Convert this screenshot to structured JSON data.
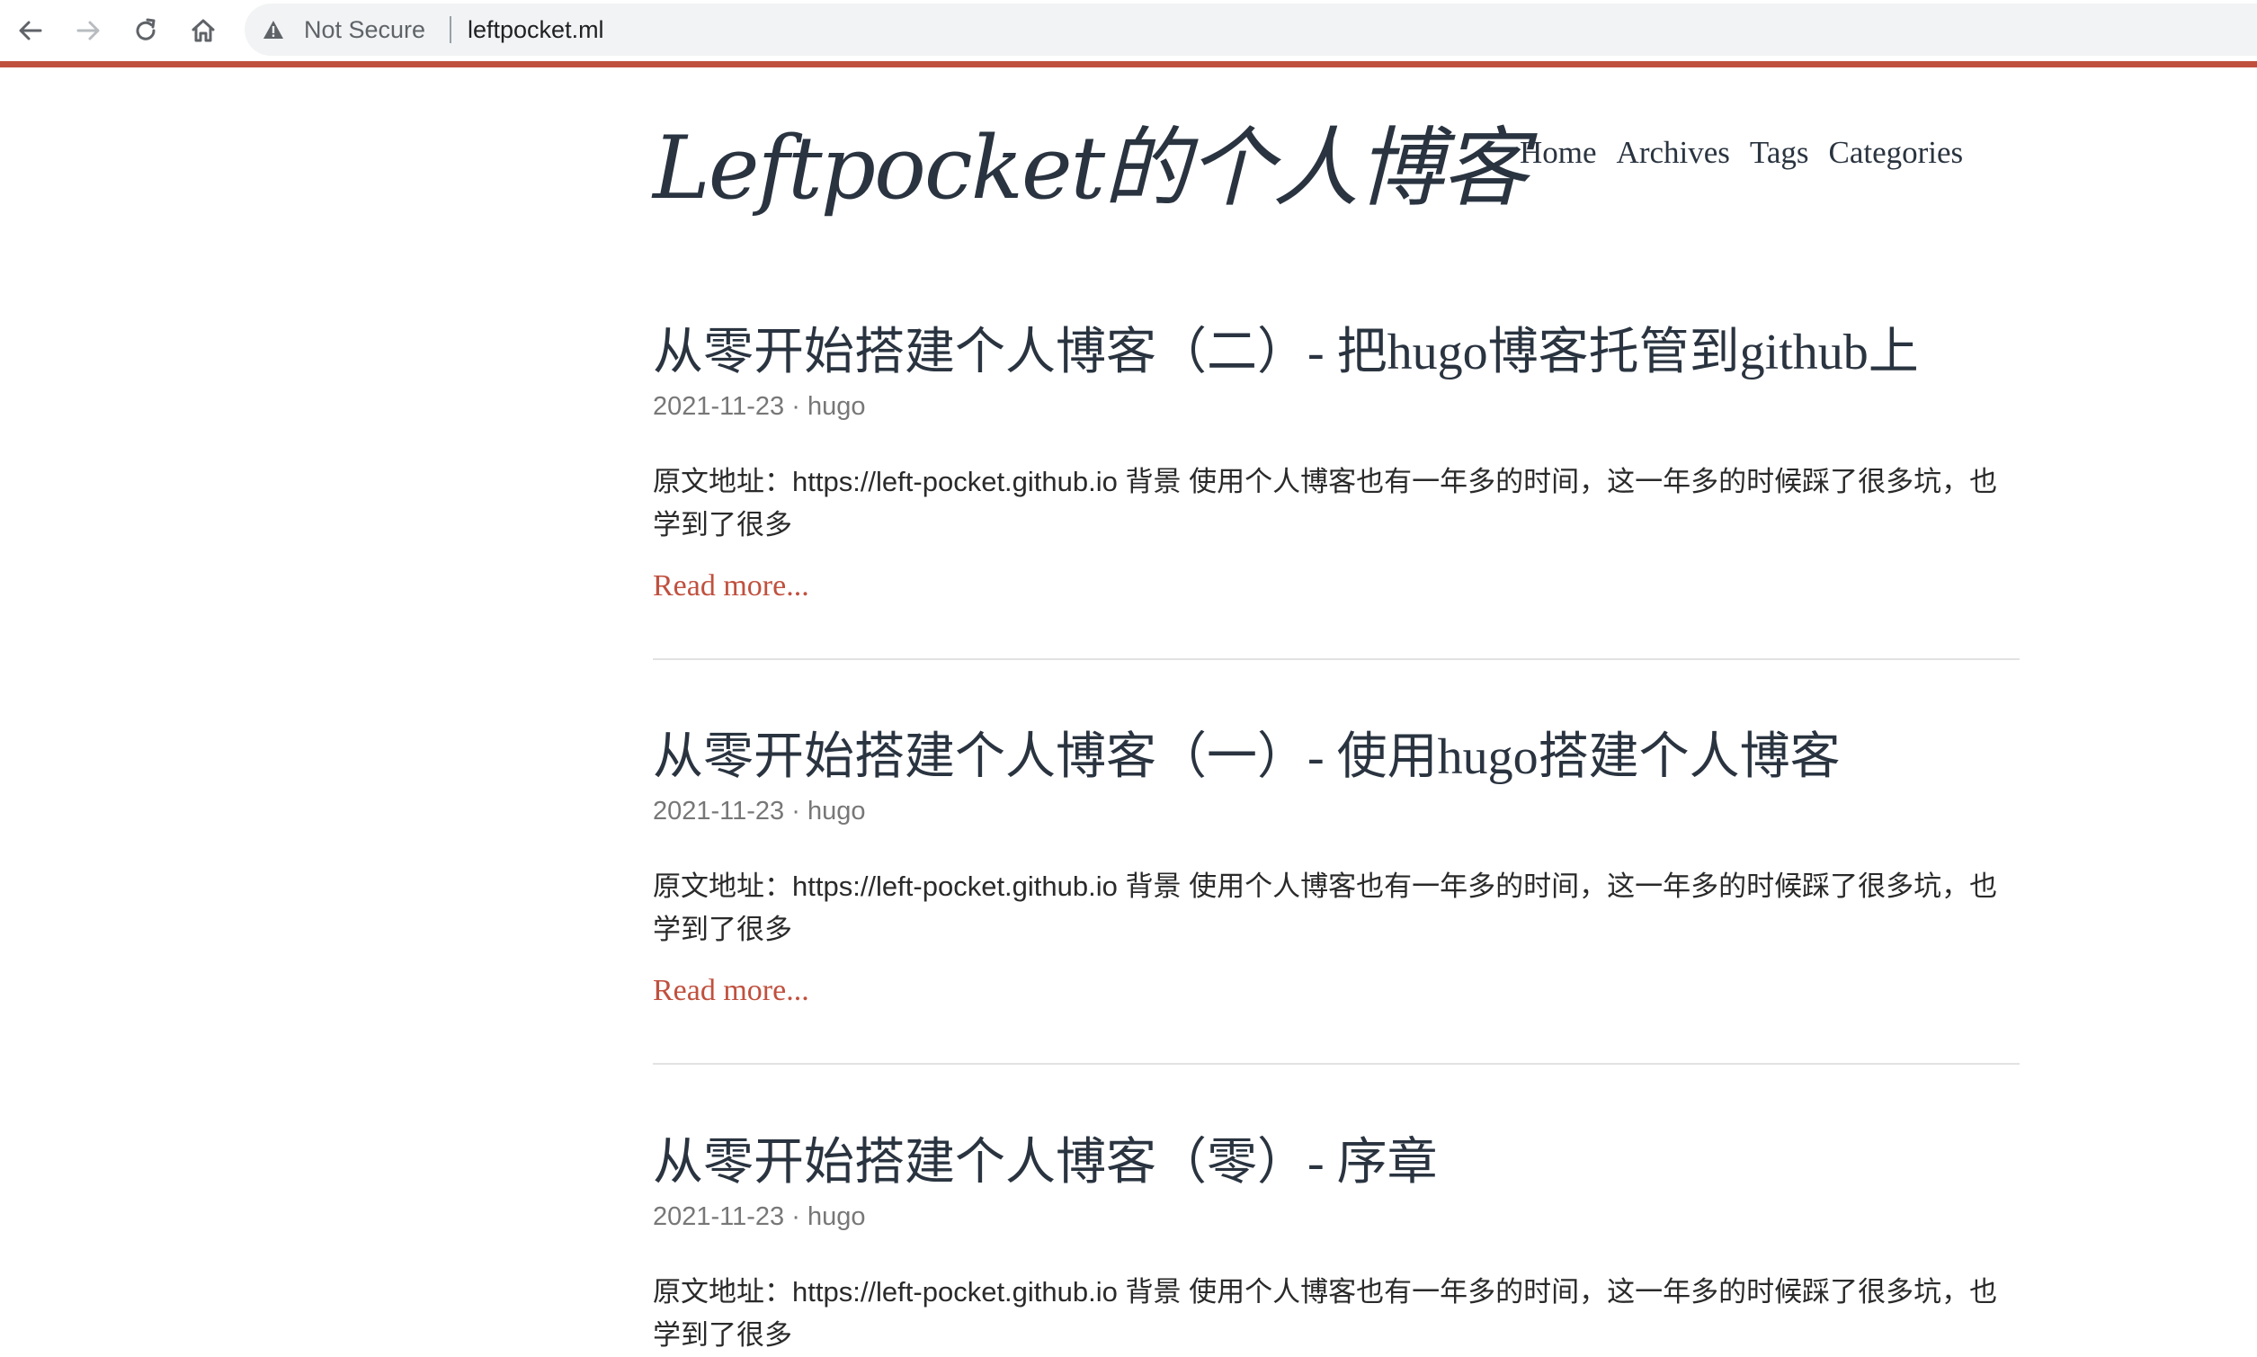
{
  "browser": {
    "security_label": "Not Secure",
    "url": "leftpocket.ml"
  },
  "site": {
    "title": "Leftpocket的个人博客",
    "nav": [
      {
        "label": "Home"
      },
      {
        "label": "Archives"
      },
      {
        "label": "Tags"
      },
      {
        "label": "Categories"
      }
    ]
  },
  "posts": [
    {
      "title": "从零开始搭建个人博客（二）- 把hugo博客托管到github上",
      "date": "2021-11-23",
      "separator": " · ",
      "category": "hugo",
      "summary": "原文地址：https://left-pocket.github.io 背景 使用个人博客也有一年多的时间，这一年多的时候踩了很多坑，也学到了很多",
      "read_more": "Read more..."
    },
    {
      "title": "从零开始搭建个人博客（一）- 使用hugo搭建个人博客",
      "date": "2021-11-23",
      "separator": " · ",
      "category": "hugo",
      "summary": "原文地址：https://left-pocket.github.io 背景 使用个人博客也有一年多的时间，这一年多的时候踩了很多坑，也学到了很多",
      "read_more": "Read more..."
    },
    {
      "title": "从零开始搭建个人博客（零）- 序章",
      "date": "2021-11-23",
      "separator": " · ",
      "category": "hugo",
      "summary": "原文地址：https://left-pocket.github.io 背景 使用个人博客也有一年多的时间，这一年多的时候踩了很多坑，也学到了很多"
    }
  ],
  "colors": {
    "accent": "#c0503e",
    "text": "#2a3440",
    "meta": "#777777",
    "omnibox_bg": "#f1f3f4"
  }
}
